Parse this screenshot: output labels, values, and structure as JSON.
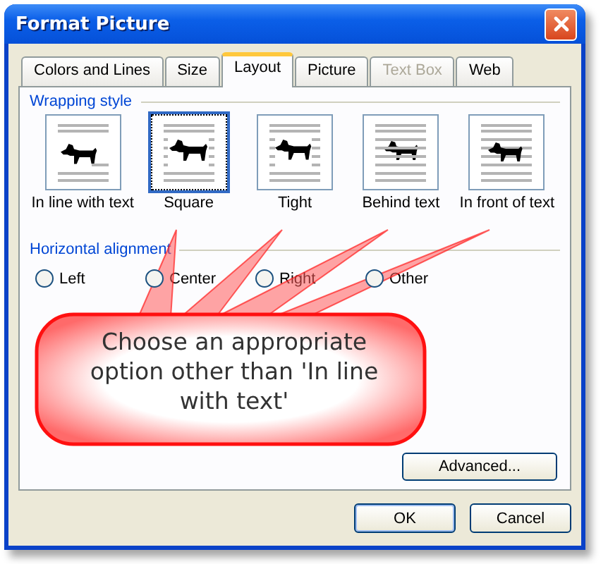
{
  "window": {
    "title": "Format Picture"
  },
  "tabs": [
    {
      "label": "Colors and Lines",
      "selected": false,
      "disabled": false
    },
    {
      "label": "Size",
      "selected": false,
      "disabled": false
    },
    {
      "label": "Layout",
      "selected": true,
      "disabled": false
    },
    {
      "label": "Picture",
      "selected": false,
      "disabled": false
    },
    {
      "label": "Text Box",
      "selected": false,
      "disabled": true
    },
    {
      "label": "Web",
      "selected": false,
      "disabled": false
    }
  ],
  "wrapping_style": {
    "legend": "Wrapping style",
    "options": [
      {
        "kind": "inline",
        "label": "In line with text",
        "selected": false
      },
      {
        "kind": "square",
        "label": "Square",
        "selected": true
      },
      {
        "kind": "tight",
        "label": "Tight",
        "selected": false
      },
      {
        "kind": "behind",
        "label": "Behind text",
        "selected": false
      },
      {
        "kind": "front",
        "label": "In front of text",
        "selected": false
      }
    ]
  },
  "horizontal_alignment": {
    "legend": "Horizontal alignment",
    "options": [
      {
        "label": "Left",
        "selected": false
      },
      {
        "label": "Center",
        "selected": false
      },
      {
        "label": "Right",
        "selected": false
      },
      {
        "label": "Other",
        "selected": false
      }
    ]
  },
  "advanced_button": "Advanced...",
  "buttons": [
    "OK",
    "Cancel"
  ],
  "callout": {
    "text": "Choose an appropriate option other than 'In line with text'"
  }
}
